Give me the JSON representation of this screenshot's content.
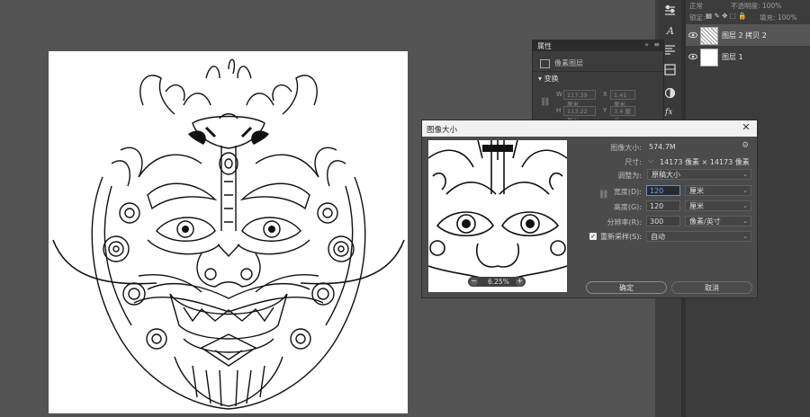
{
  "layers_panel": {
    "top_row1_left": "正常",
    "top_row1_right": "不透明度: 100%",
    "lock_label": "锁定:",
    "fill_label": "填充: 100%",
    "layers": [
      {
        "name": "图层 2 拷贝 2",
        "selected": true
      },
      {
        "name": "图层 1",
        "selected": false
      }
    ]
  },
  "properties_panel": {
    "tab": "属性",
    "type_label": "像素图层",
    "section": "变换",
    "w_label": "W",
    "w_value": "117.39 厘米",
    "x_label": "X",
    "x_value": "1.41 厘米",
    "h_label": "H",
    "h_value": "113.22 厘米",
    "y_label": "Y",
    "y_value": "3.4 厘米"
  },
  "dialog": {
    "title": "图像大小",
    "image_size_label": "图像大小:",
    "image_size_value": "574.7M",
    "dimensions_label": "尺寸:",
    "dimensions_value": "14173 像素  ×  14173 像素",
    "fit_label": "调整为:",
    "fit_value": "原稿大小",
    "width_label": "宽度(D):",
    "width_value": "120",
    "width_unit": "厘米",
    "height_label": "高度(G):",
    "height_value": "120",
    "height_unit": "厘米",
    "resolution_label": "分辨率(R):",
    "resolution_value": "300",
    "resolution_unit": "像素/英寸",
    "resample_label": "重新采样(S):",
    "resample_value": "自动",
    "resample_checked": true,
    "zoom_value": "6.25%",
    "ok_label": "确定",
    "cancel_label": "取消"
  },
  "colors": {
    "workspace": "#535353",
    "panel": "#3c3c3c",
    "dialog": "#4b4b4b",
    "accent": "#6fa2ff"
  }
}
